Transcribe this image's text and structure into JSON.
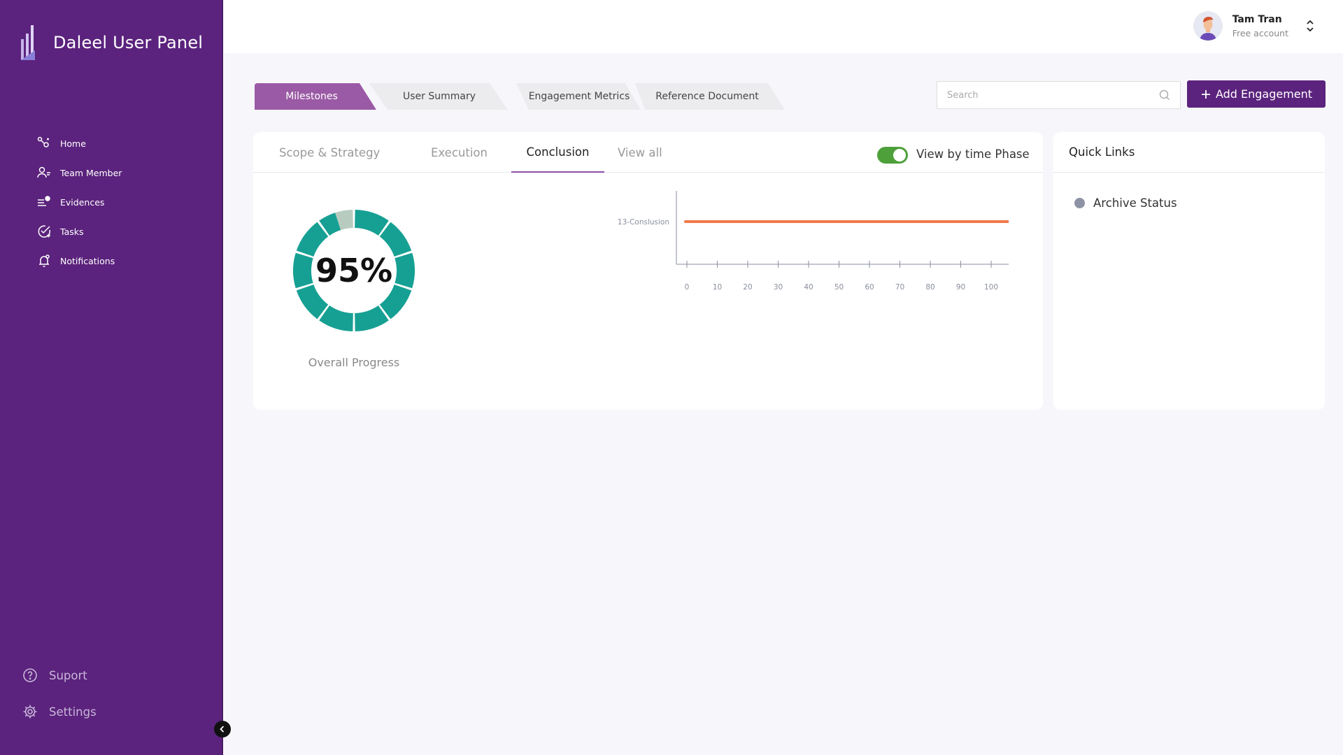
{
  "brand": {
    "name": "Daleel User Panel"
  },
  "sidebar": {
    "items": [
      {
        "label": "Home",
        "icon": "home-icon"
      },
      {
        "label": "Team Member",
        "icon": "team-icon"
      },
      {
        "label": "Evidences",
        "icon": "evidences-icon"
      },
      {
        "label": "Tasks",
        "icon": "tasks-icon"
      },
      {
        "label": "Notifications",
        "icon": "bell-icon"
      }
    ],
    "bottom": [
      {
        "label": "Suport",
        "icon": "help-icon"
      },
      {
        "label": "Settings",
        "icon": "gear-icon"
      }
    ]
  },
  "user": {
    "name": "Tam Tran",
    "plan": "Free account"
  },
  "tabs": [
    {
      "label": "Milestones",
      "active": true
    },
    {
      "label": "User Summary",
      "active": false
    },
    {
      "label": "Engagement Metrics",
      "active": false
    },
    {
      "label": "Reference Document",
      "active": false
    }
  ],
  "search": {
    "placeholder": "Search"
  },
  "add_button": {
    "label": "Add Engagement"
  },
  "subtabs": [
    {
      "label": "Scope & Strategy",
      "active": false
    },
    {
      "label": "Execution",
      "active": false
    },
    {
      "label": "Conclusion",
      "active": true
    },
    {
      "label": "View all",
      "active": false
    }
  ],
  "toggle": {
    "label": "View by time Phase",
    "on": true
  },
  "progress": {
    "value_text": "95%",
    "value": 95,
    "label": "Overall Progress"
  },
  "quick_links": {
    "title": "Quick Links",
    "items": [
      {
        "label": "Archive Status"
      }
    ]
  },
  "colors": {
    "sidebar": "#5b237d",
    "accent": "#5b237d",
    "active_tab": "#9b5aa5",
    "progress": "#16a093",
    "progress_remaining": "#b7cbbf",
    "bar": "#f07a4a",
    "toggle_on": "#4ea03a"
  },
  "chart_data": {
    "type": "bar",
    "categories": [
      "13-Conslusion"
    ],
    "values": [
      [
        0,
        100
      ]
    ],
    "xticks": [
      0,
      10,
      20,
      30,
      40,
      50,
      60,
      70,
      80,
      90,
      100
    ],
    "xlim": [
      0,
      100
    ]
  }
}
